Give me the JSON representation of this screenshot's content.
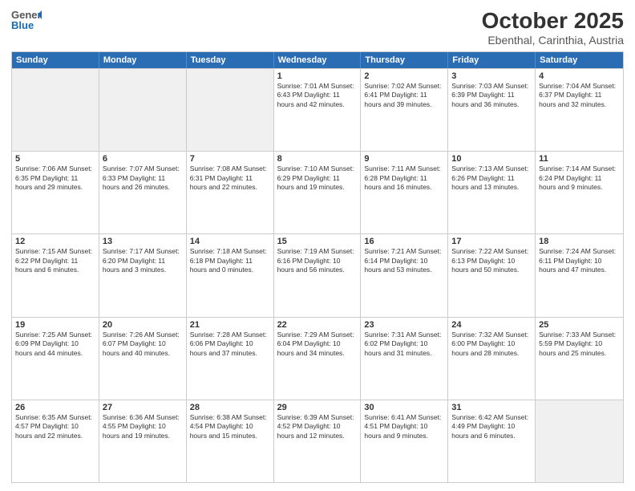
{
  "header": {
    "logo_general": "General",
    "logo_blue": "Blue",
    "title": "October 2025",
    "subtitle": "Ebenthal, Carinthia, Austria"
  },
  "days_of_week": [
    "Sunday",
    "Monday",
    "Tuesday",
    "Wednesday",
    "Thursday",
    "Friday",
    "Saturday"
  ],
  "weeks": [
    [
      {
        "day": "",
        "info": ""
      },
      {
        "day": "",
        "info": ""
      },
      {
        "day": "",
        "info": ""
      },
      {
        "day": "1",
        "info": "Sunrise: 7:01 AM\nSunset: 6:43 PM\nDaylight: 11 hours\nand 42 minutes."
      },
      {
        "day": "2",
        "info": "Sunrise: 7:02 AM\nSunset: 6:41 PM\nDaylight: 11 hours\nand 39 minutes."
      },
      {
        "day": "3",
        "info": "Sunrise: 7:03 AM\nSunset: 6:39 PM\nDaylight: 11 hours\nand 36 minutes."
      },
      {
        "day": "4",
        "info": "Sunrise: 7:04 AM\nSunset: 6:37 PM\nDaylight: 11 hours\nand 32 minutes."
      }
    ],
    [
      {
        "day": "5",
        "info": "Sunrise: 7:06 AM\nSunset: 6:35 PM\nDaylight: 11 hours\nand 29 minutes."
      },
      {
        "day": "6",
        "info": "Sunrise: 7:07 AM\nSunset: 6:33 PM\nDaylight: 11 hours\nand 26 minutes."
      },
      {
        "day": "7",
        "info": "Sunrise: 7:08 AM\nSunset: 6:31 PM\nDaylight: 11 hours\nand 22 minutes."
      },
      {
        "day": "8",
        "info": "Sunrise: 7:10 AM\nSunset: 6:29 PM\nDaylight: 11 hours\nand 19 minutes."
      },
      {
        "day": "9",
        "info": "Sunrise: 7:11 AM\nSunset: 6:28 PM\nDaylight: 11 hours\nand 16 minutes."
      },
      {
        "day": "10",
        "info": "Sunrise: 7:13 AM\nSunset: 6:26 PM\nDaylight: 11 hours\nand 13 minutes."
      },
      {
        "day": "11",
        "info": "Sunrise: 7:14 AM\nSunset: 6:24 PM\nDaylight: 11 hours\nand 9 minutes."
      }
    ],
    [
      {
        "day": "12",
        "info": "Sunrise: 7:15 AM\nSunset: 6:22 PM\nDaylight: 11 hours\nand 6 minutes."
      },
      {
        "day": "13",
        "info": "Sunrise: 7:17 AM\nSunset: 6:20 PM\nDaylight: 11 hours\nand 3 minutes."
      },
      {
        "day": "14",
        "info": "Sunrise: 7:18 AM\nSunset: 6:18 PM\nDaylight: 11 hours\nand 0 minutes."
      },
      {
        "day": "15",
        "info": "Sunrise: 7:19 AM\nSunset: 6:16 PM\nDaylight: 10 hours\nand 56 minutes."
      },
      {
        "day": "16",
        "info": "Sunrise: 7:21 AM\nSunset: 6:14 PM\nDaylight: 10 hours\nand 53 minutes."
      },
      {
        "day": "17",
        "info": "Sunrise: 7:22 AM\nSunset: 6:13 PM\nDaylight: 10 hours\nand 50 minutes."
      },
      {
        "day": "18",
        "info": "Sunrise: 7:24 AM\nSunset: 6:11 PM\nDaylight: 10 hours\nand 47 minutes."
      }
    ],
    [
      {
        "day": "19",
        "info": "Sunrise: 7:25 AM\nSunset: 6:09 PM\nDaylight: 10 hours\nand 44 minutes."
      },
      {
        "day": "20",
        "info": "Sunrise: 7:26 AM\nSunset: 6:07 PM\nDaylight: 10 hours\nand 40 minutes."
      },
      {
        "day": "21",
        "info": "Sunrise: 7:28 AM\nSunset: 6:06 PM\nDaylight: 10 hours\nand 37 minutes."
      },
      {
        "day": "22",
        "info": "Sunrise: 7:29 AM\nSunset: 6:04 PM\nDaylight: 10 hours\nand 34 minutes."
      },
      {
        "day": "23",
        "info": "Sunrise: 7:31 AM\nSunset: 6:02 PM\nDaylight: 10 hours\nand 31 minutes."
      },
      {
        "day": "24",
        "info": "Sunrise: 7:32 AM\nSunset: 6:00 PM\nDaylight: 10 hours\nand 28 minutes."
      },
      {
        "day": "25",
        "info": "Sunrise: 7:33 AM\nSunset: 5:59 PM\nDaylight: 10 hours\nand 25 minutes."
      }
    ],
    [
      {
        "day": "26",
        "info": "Sunrise: 6:35 AM\nSunset: 4:57 PM\nDaylight: 10 hours\nand 22 minutes."
      },
      {
        "day": "27",
        "info": "Sunrise: 6:36 AM\nSunset: 4:55 PM\nDaylight: 10 hours\nand 19 minutes."
      },
      {
        "day": "28",
        "info": "Sunrise: 6:38 AM\nSunset: 4:54 PM\nDaylight: 10 hours\nand 15 minutes."
      },
      {
        "day": "29",
        "info": "Sunrise: 6:39 AM\nSunset: 4:52 PM\nDaylight: 10 hours\nand 12 minutes."
      },
      {
        "day": "30",
        "info": "Sunrise: 6:41 AM\nSunset: 4:51 PM\nDaylight: 10 hours\nand 9 minutes."
      },
      {
        "day": "31",
        "info": "Sunrise: 6:42 AM\nSunset: 4:49 PM\nDaylight: 10 hours\nand 6 minutes."
      },
      {
        "day": "",
        "info": ""
      }
    ]
  ]
}
